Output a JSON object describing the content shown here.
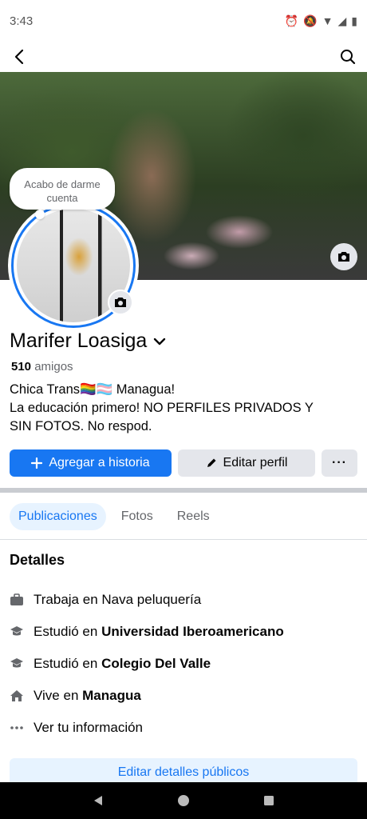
{
  "status_bar": {
    "time": "3:43"
  },
  "cover": {
    "description_icon": "camera-icon"
  },
  "note": {
    "text": "Acabo de darme cuenta"
  },
  "profile": {
    "name": "Marifer Loasiga",
    "friends_count": "510",
    "friends_label": "amigos",
    "bio": {
      "line1": "Chica Trans🏳️‍🌈🏳️‍⚧️ Managua!",
      "line2": "La educación primero!  NO PERFILES PRIVADOS Y",
      "line3": "SIN FOTOS. No respod."
    }
  },
  "actions": {
    "add_story": "Agregar a historia",
    "edit_profile": "Editar perfil",
    "more": "···"
  },
  "tabs": [
    {
      "label": "Publicaciones"
    },
    {
      "label": "Fotos"
    },
    {
      "label": "Reels"
    }
  ],
  "details": {
    "title": "Detalles",
    "work": {
      "prefix": "Trabaja en",
      "value": "Nava peluquería"
    },
    "study1": {
      "prefix": "Estudió en",
      "value": "Universidad Iberoamericano"
    },
    "study2": {
      "prefix": "Estudió en",
      "value": "Colegio Del Valle"
    },
    "lives": {
      "prefix": "Vive en",
      "value": "Managua"
    },
    "more_info": "Ver tu información"
  },
  "edit_public_details": "Editar detalles públicos",
  "colors": {
    "accent": "#1877f2",
    "accent_light": "#e7f3ff",
    "secondary_btn": "#e4e6eb",
    "muted_text": "#65676b"
  }
}
